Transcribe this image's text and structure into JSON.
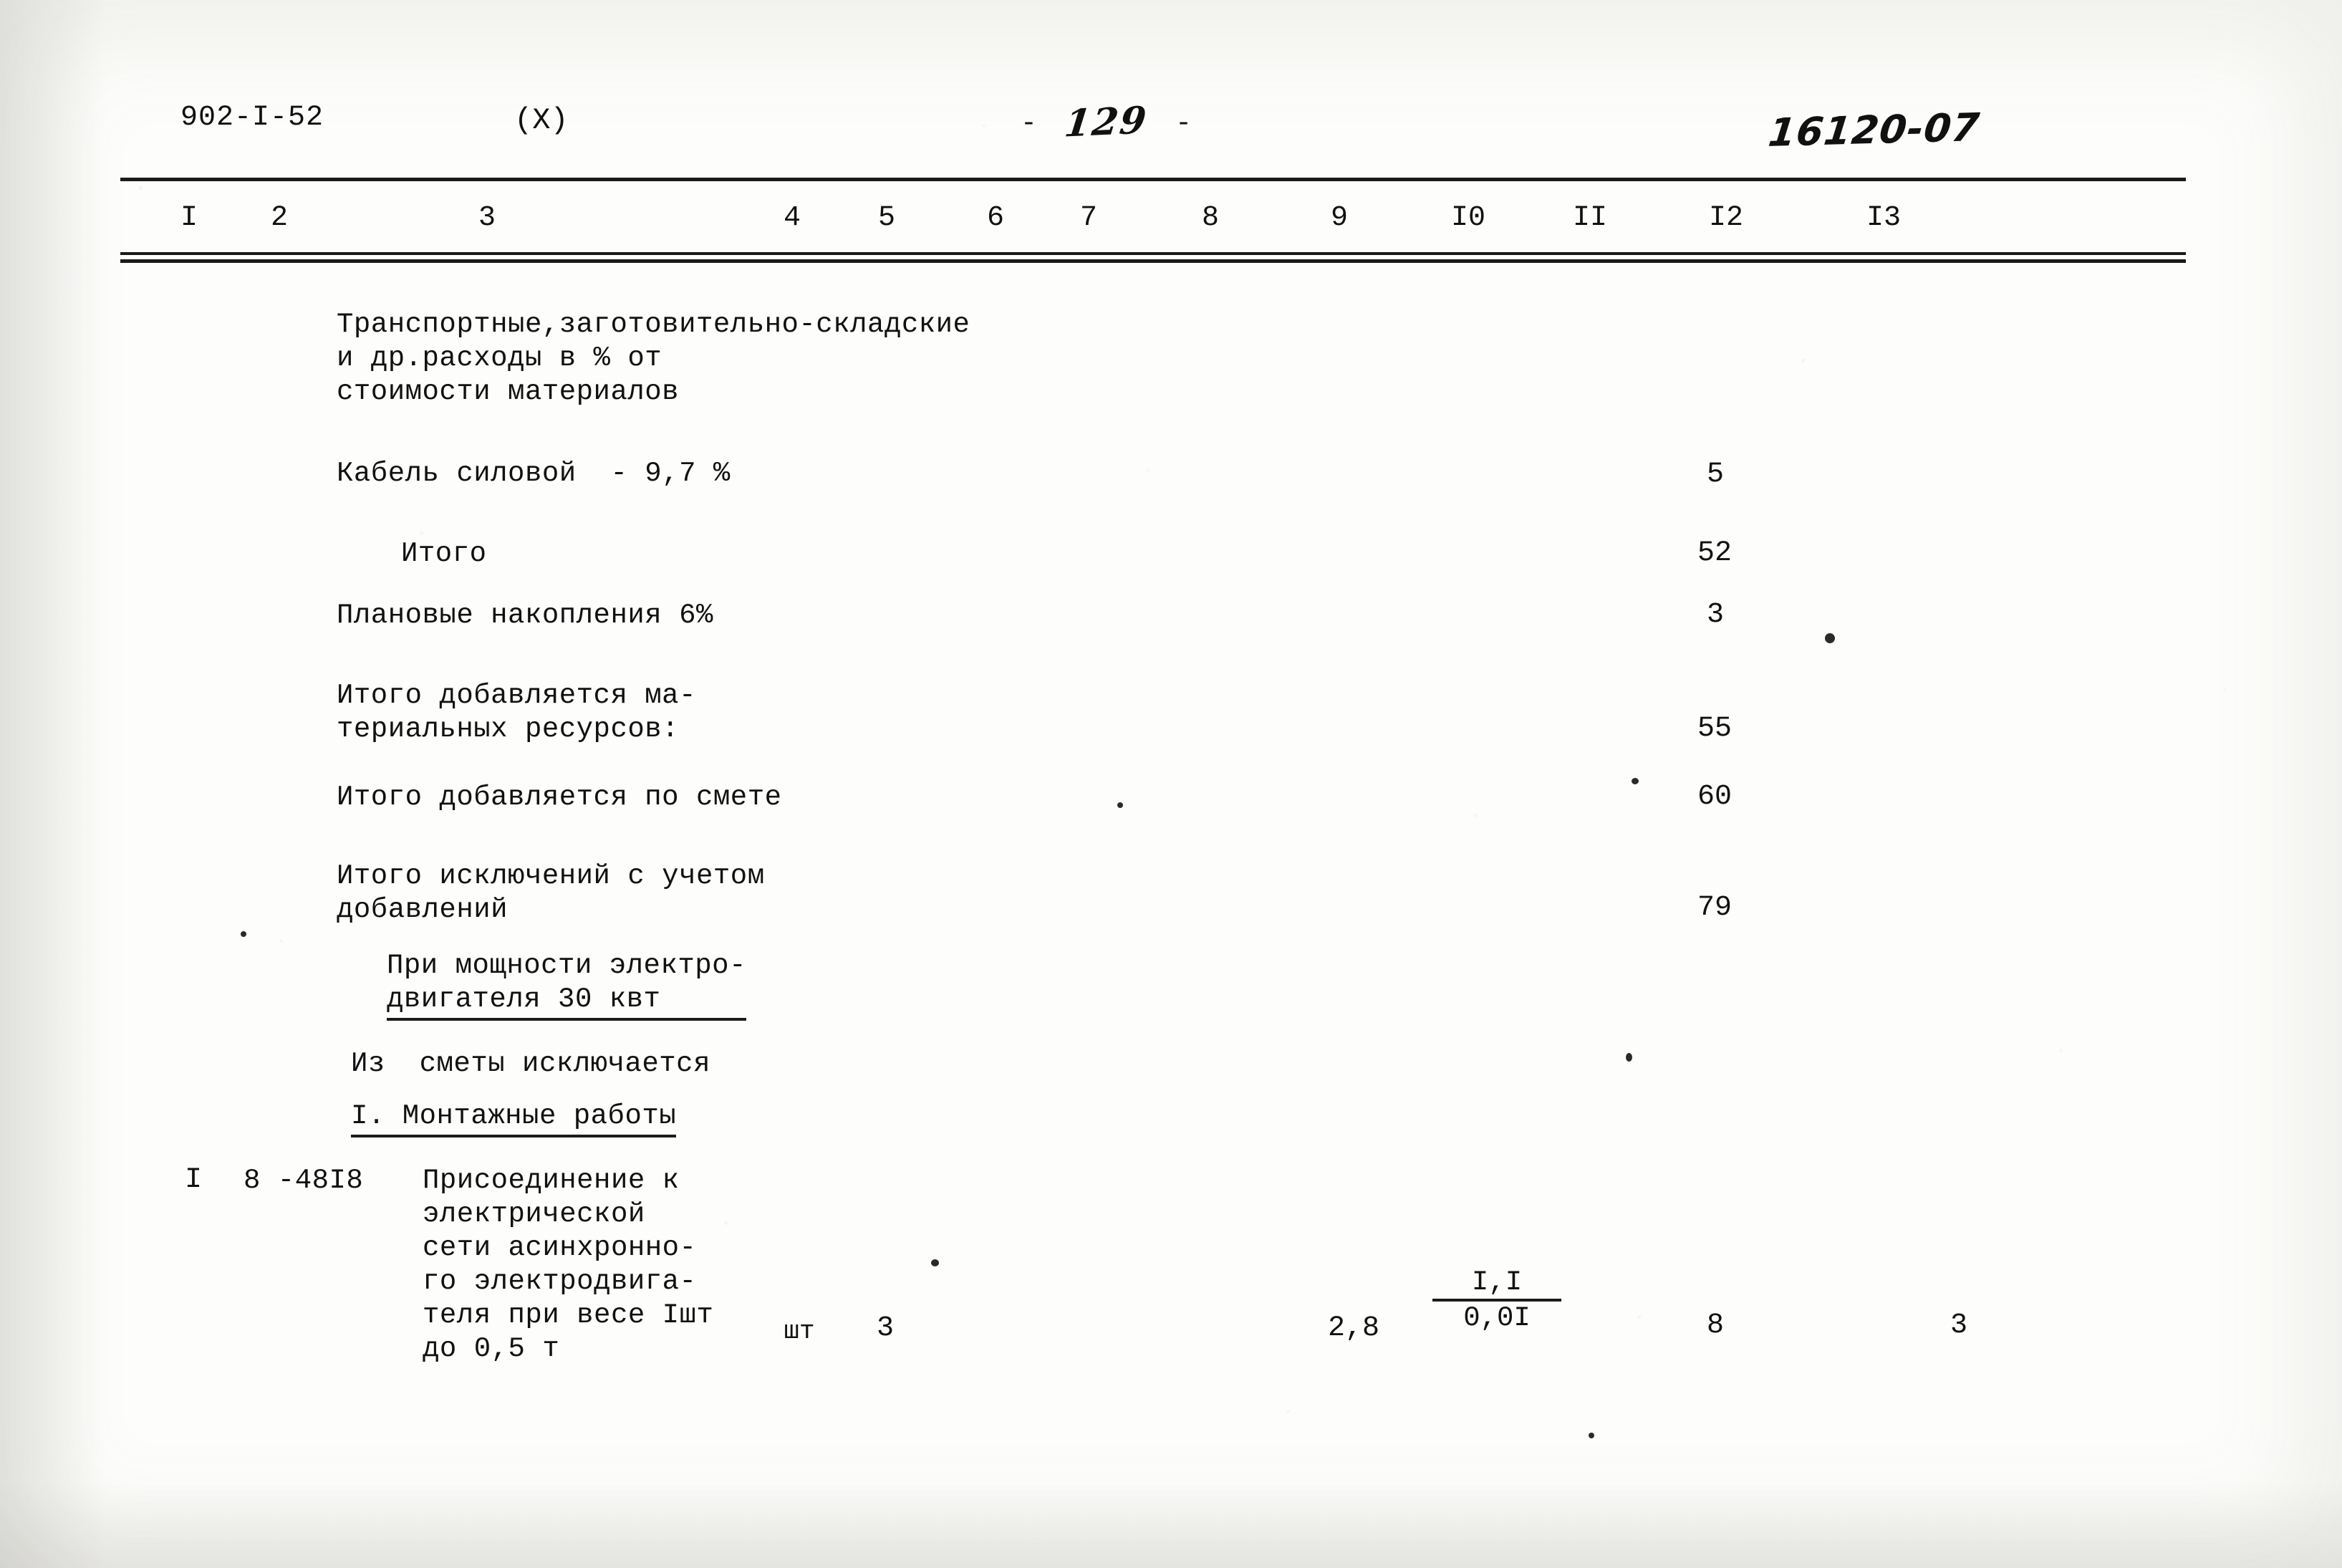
{
  "header": {
    "doc_code": "902-I-52",
    "variant_mark": "(X)",
    "page_dash_left": "-",
    "page_number": "129",
    "page_dash_right": "-",
    "sheet_code": "16120-07"
  },
  "table": {
    "column_numbers": [
      "I",
      "2",
      "3",
      "4",
      "5",
      "6",
      "7",
      "8",
      "9",
      "I0",
      "II",
      "I2",
      "I3"
    ],
    "rows": [
      {
        "name": "transport-overhead-heading",
        "col3": "Транспортные,заготовительно-складские\nи др.расходы в % от\nстоимости материалов",
        "col12": ""
      },
      {
        "name": "power-cable-percent",
        "col3": "Кабель силовой  - 9,7 %",
        "col12": "5"
      },
      {
        "name": "subtotal",
        "col3": "Итого",
        "col12": "52"
      },
      {
        "name": "planned-savings",
        "col3": "Плановые накопления 6%",
        "col12": "3"
      },
      {
        "name": "total-added-material-resources",
        "col3": "Итого добавляется ма-\nтериальных ресурсов:",
        "col12": "55"
      },
      {
        "name": "total-added-by-estimate",
        "col3": "Итого добавляется по смете",
        "col12": "60"
      },
      {
        "name": "total-exclusions-with-additions",
        "col3": "Итого исключений с учетом\nдобавлений",
        "col12": "79"
      },
      {
        "name": "motor-power-heading",
        "col3": "При мощности электро-\nдвигателя 30 квт",
        "col12": ""
      },
      {
        "name": "excluded-from-estimate-heading",
        "col3": "Из  сметы исключается",
        "col12": ""
      },
      {
        "name": "installation-works-heading",
        "col3": "I. Монтажные работы",
        "col12": ""
      },
      {
        "name": "motor-connection-item",
        "col1": "I",
        "col2": "8 -48I8",
        "col3": "Присоединение к\nэлектрической\nсети асинхронно-\nго электродвига-\nтеля при весе Iшт\nдо 0,5 т",
        "col4": "шт",
        "col5": "3",
        "col9": "2,8",
        "col10_numerator": "I,I",
        "col10_denominator": "0,0I",
        "col12": "8",
        "col13": "3"
      }
    ]
  }
}
